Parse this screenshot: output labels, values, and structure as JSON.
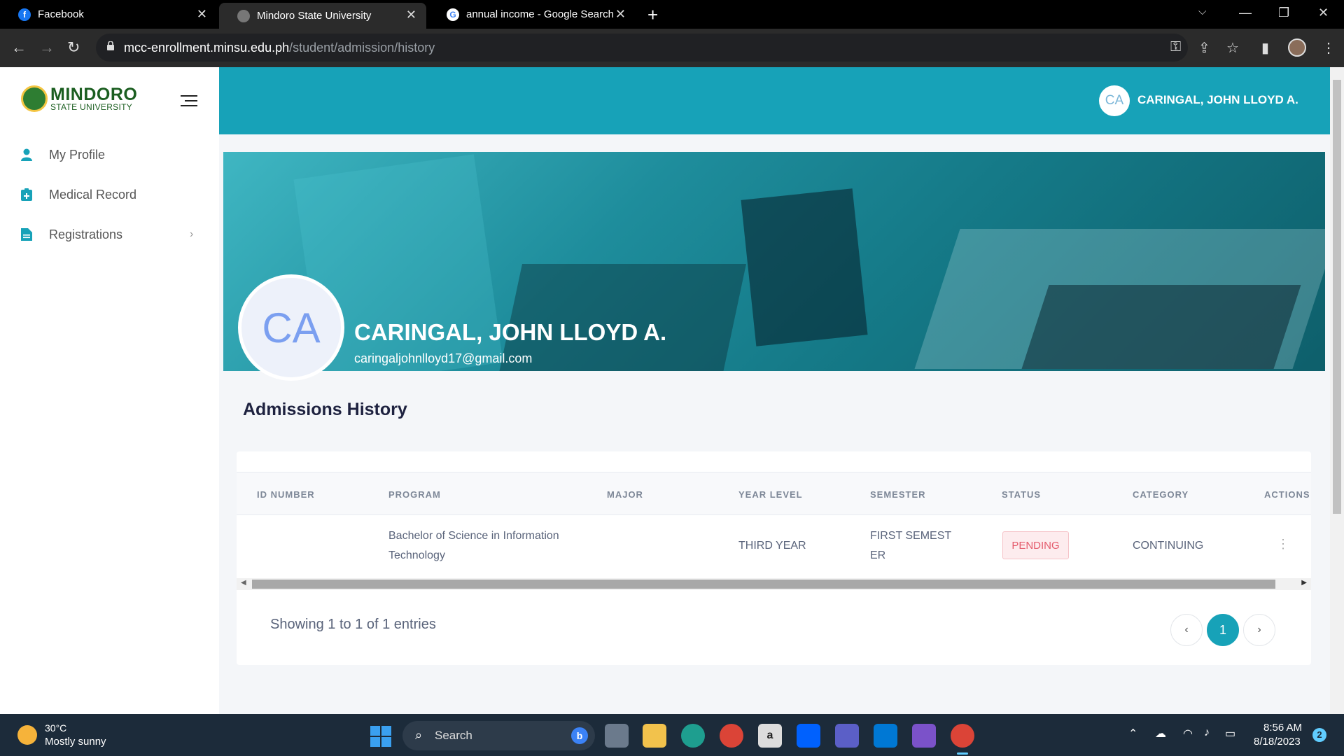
{
  "browser": {
    "tabs": [
      {
        "title": "Facebook",
        "icon": "facebook-icon"
      },
      {
        "title": "Mindoro State University",
        "icon": "globe-icon"
      },
      {
        "title": "annual income - Google Search",
        "icon": "google-icon"
      }
    ],
    "url_domain": "mcc-enrollment.minsu.edu.ph",
    "url_path": "/student/admission/history"
  },
  "sidebar": {
    "logo_line1": "MINDORO",
    "logo_line2": "STATE UNIVERSITY",
    "items": [
      {
        "label": "My Profile",
        "icon": "user-icon"
      },
      {
        "label": "Medical Record",
        "icon": "medical-icon"
      },
      {
        "label": "Registrations",
        "icon": "document-icon",
        "has_submenu": true
      }
    ]
  },
  "header": {
    "avatar_initials": "CA",
    "user_name": "CARINGAL, JOHN LLOYD A."
  },
  "banner": {
    "avatar_initials": "CA",
    "name": "CARINGAL, JOHN LLOYD A.",
    "email": "caringaljohnlloyd17@gmail.com"
  },
  "section_title": "Admissions History",
  "table": {
    "columns": [
      "ID NUMBER",
      "PROGRAM",
      "MAJOR",
      "YEAR LEVEL",
      "SEMESTER",
      "STATUS",
      "CATEGORY",
      "ACTIONS"
    ],
    "rows": [
      {
        "id_number": "",
        "program_line1": "Bachelor of Science in Information",
        "program_line2": "Technology",
        "major": "",
        "year_level": "THIRD YEAR",
        "semester_line1": "FIRST SEMEST",
        "semester_line2": "ER",
        "status": "PENDING",
        "category": "CONTINUING",
        "actions": "⋮"
      }
    ],
    "entries_info": "Showing 1 to 1 of 1 entries",
    "pagination": {
      "prev": "‹",
      "current": "1",
      "next": "›"
    }
  },
  "taskbar": {
    "weather_temp": "30°C",
    "weather_desc": "Mostly sunny",
    "search_label": "Search",
    "time": "8:56 AM",
    "date": "8/18/2023",
    "notification_count": "2"
  },
  "colors": {
    "accent": "#17a2b8",
    "status_pending": "#e45a6b"
  }
}
